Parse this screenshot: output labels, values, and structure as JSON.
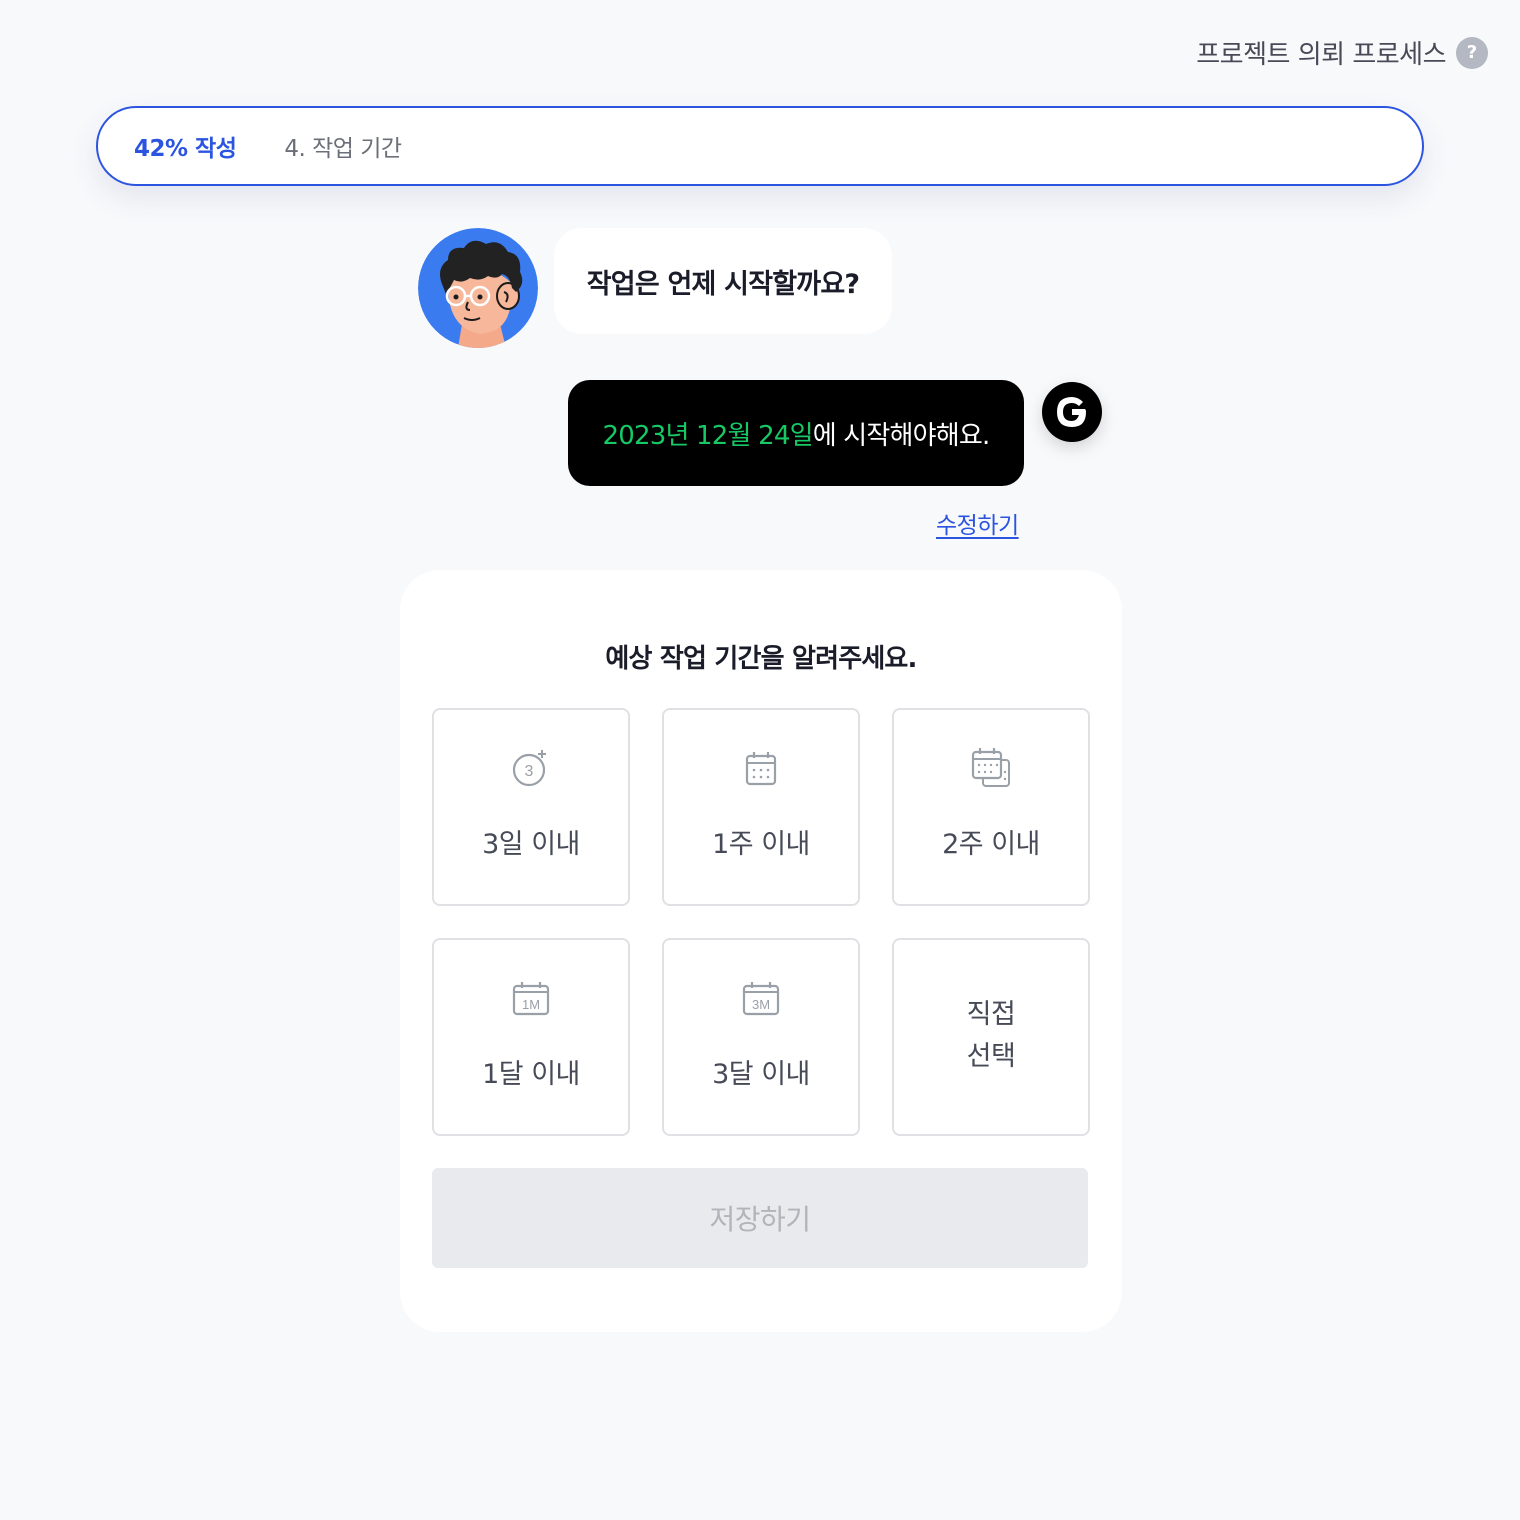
{
  "header": {
    "process_label": "프로젝트 의뢰 프로세스",
    "help_icon": "question-mark-icon",
    "help_glyph": "?"
  },
  "progress": {
    "percent_label": "42% 작성",
    "step_label": "4. 작업 기간"
  },
  "chat": {
    "bot_question": "작업은 언제 시작할까요?",
    "user_answer_highlight": "2023년 12월 24일",
    "user_answer_rest": "에 시작해야해요.",
    "edit_label": "수정하기"
  },
  "card": {
    "title": "예상 작업 기간을 알려주세요.",
    "options": [
      {
        "label": "3일 이내",
        "icon": "three-days-icon"
      },
      {
        "label": "1주 이내",
        "icon": "calendar-icon"
      },
      {
        "label": "2주 이내",
        "icon": "two-calendars-icon"
      },
      {
        "label": "1달 이내",
        "icon": "calendar-1m-icon",
        "icon_text": "1M"
      },
      {
        "label": "3달 이내",
        "icon": "calendar-3m-icon",
        "icon_text": "3M"
      },
      {
        "label": "직접\n선택",
        "icon": ""
      }
    ],
    "save_label": "저장하기"
  },
  "colors": {
    "accent": "#2b54e0",
    "highlight_green": "#17c964",
    "avatar_bg": "#3b7bf0"
  }
}
